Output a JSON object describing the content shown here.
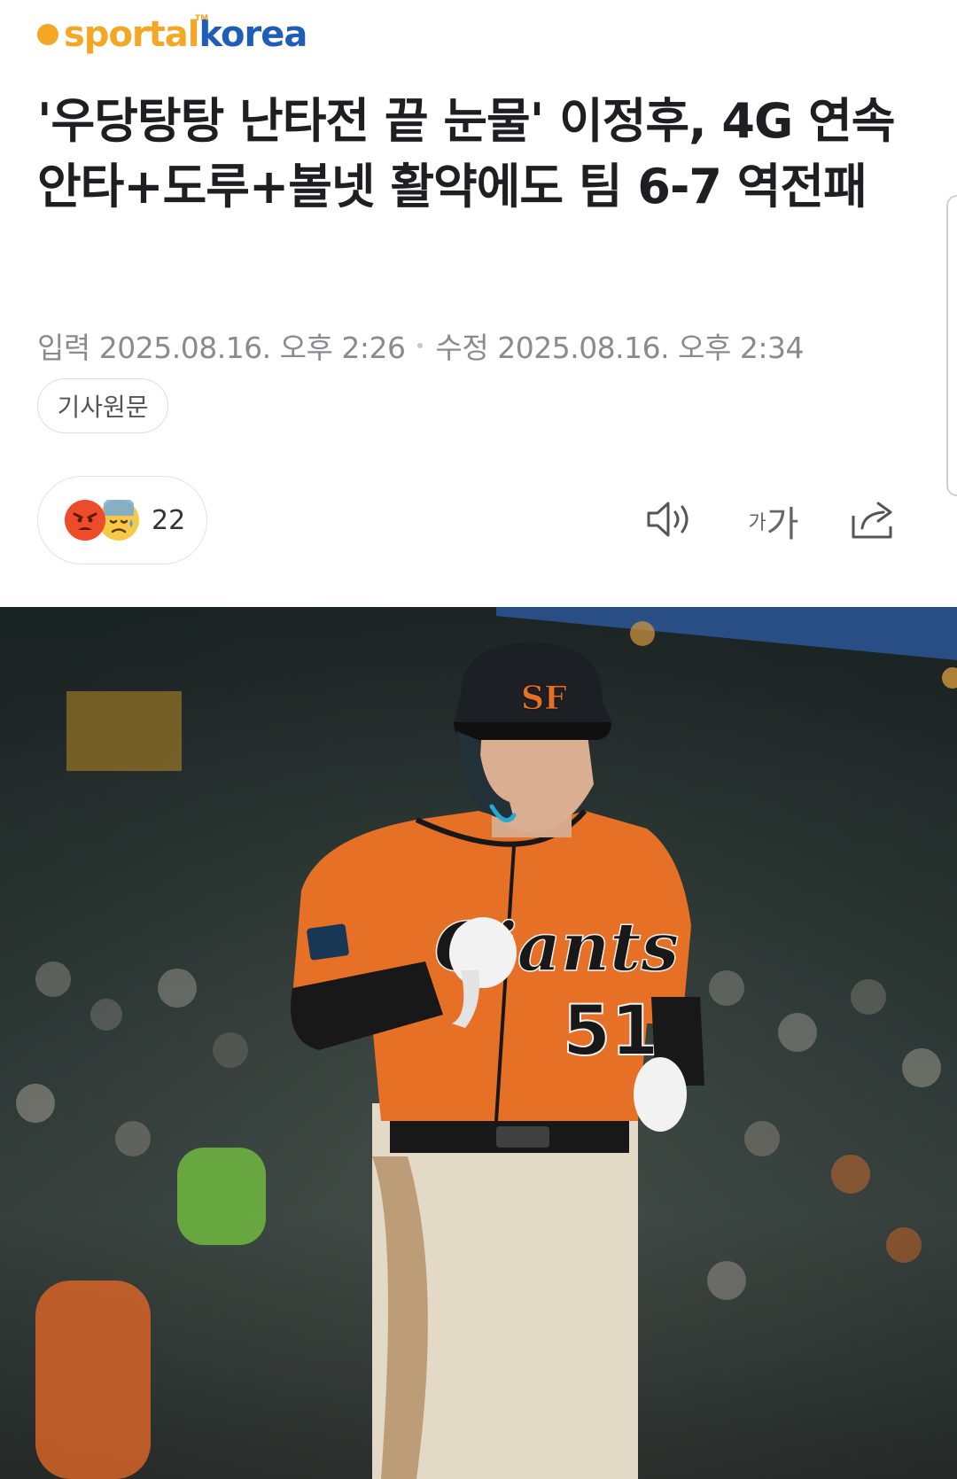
{
  "header": {
    "logo_part1": "sportal",
    "logo_part2": "korea",
    "logo_tm": "TM"
  },
  "article": {
    "title": "'우당탕탕 난타전 끝 눈물' 이정후, 4G 연속 안타+도루+볼넷 활약에도 팀 6-7 역전패",
    "published_label": "입력",
    "published_time": "2025.08.16. 오후 2:26",
    "modified_label": "수정",
    "modified_time": "2025.08.16. 오후 2:34",
    "original_link_label": "기사원문"
  },
  "reactions": {
    "count": "22",
    "icons": [
      "angry-emoji",
      "sad-sweat-emoji"
    ]
  },
  "toolbar": {
    "font_small": "가",
    "font_large": "가",
    "icons": [
      "speaker-icon",
      "font-size-icon",
      "share-icon"
    ]
  },
  "photo": {
    "jersey_number": "51",
    "cap_logo": "SF",
    "jersey_script": "Giants"
  },
  "colors": {
    "logo_orange": "#f5a623",
    "logo_blue": "#1f5db8",
    "jersey_orange": "#f4762a",
    "text_dark": "#1e1e23",
    "text_meta": "#8a8a90"
  }
}
